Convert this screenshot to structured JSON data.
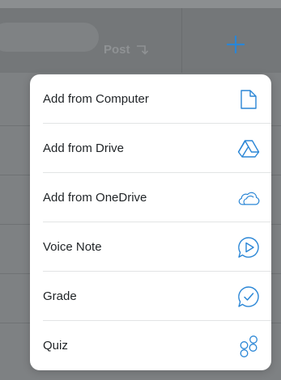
{
  "toolbar": {
    "post_label": "Post",
    "post_icon": "reply-arrow-icon",
    "add_icon": "plus-icon"
  },
  "menu": {
    "items": [
      {
        "label": "Add from Computer",
        "icon": "file-icon"
      },
      {
        "label": "Add from Drive",
        "icon": "drive-icon"
      },
      {
        "label": "Add from OneDrive",
        "icon": "cloud-icon"
      },
      {
        "label": "Voice Note",
        "icon": "voice-note-icon"
      },
      {
        "label": "Grade",
        "icon": "grade-icon"
      },
      {
        "label": "Quiz",
        "icon": "quiz-icon"
      }
    ]
  },
  "colors": {
    "accent": "#2a86d6",
    "menu_text": "#1f2326",
    "overlay": "#7e8183"
  }
}
